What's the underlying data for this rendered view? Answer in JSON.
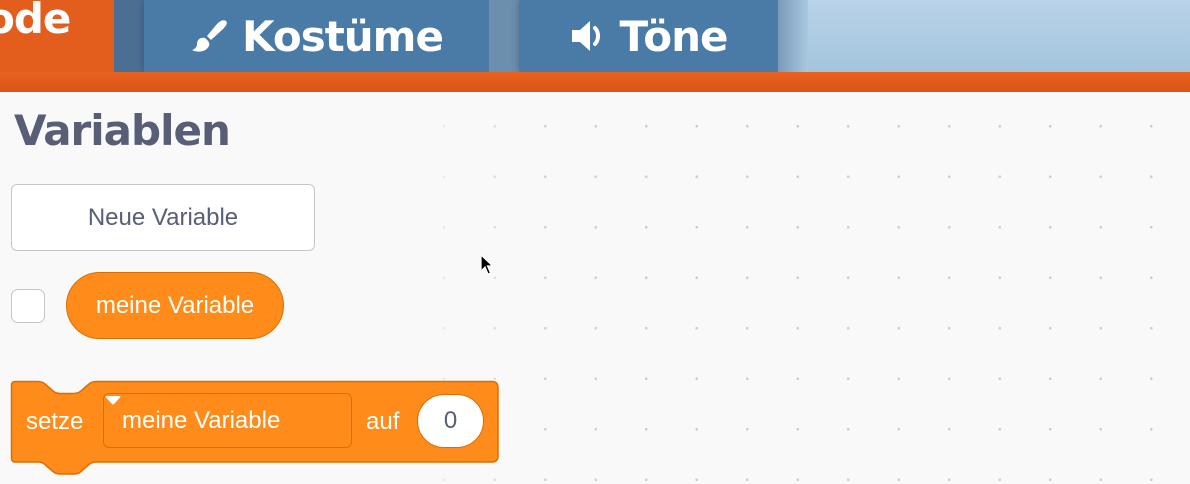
{
  "tabs": {
    "code_label": "Code",
    "code_visible": "ode",
    "costumes_label": "Kostüme",
    "sounds_label": "Töne"
  },
  "palette": {
    "section_title": "Variablen",
    "new_variable_button": "Neue Variable",
    "variable_reporter": "meine Variable",
    "variable_checked": false,
    "set_block": {
      "keyword_set": "setze",
      "selected_variable": "meine Variable",
      "keyword_to": "auf",
      "value": "0"
    }
  },
  "colors": {
    "tab_orange": "#e35e1d",
    "tab_blue": "#4a7aa6",
    "variables_category": "#ff8c1a",
    "variables_border": "#db6e00",
    "text_muted": "#575e75"
  },
  "icons": {
    "costumes_tab": "brush-icon",
    "sounds_tab": "speaker-icon",
    "dropdown": "caret-down-icon",
    "pointer": "mouse-cursor-icon"
  }
}
